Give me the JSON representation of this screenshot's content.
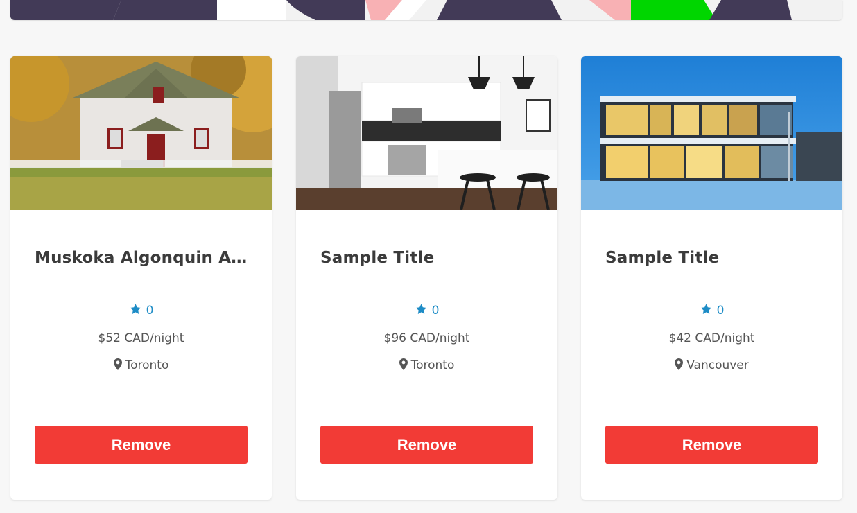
{
  "cards": [
    {
      "title": "Muskoka Algonquin Arr...",
      "rating": "0",
      "price": "$52 CAD/night",
      "location": "Toronto",
      "remove_label": "Remove",
      "image": "house-exterior-autumn"
    },
    {
      "title": "Sample Title",
      "rating": "0",
      "price": "$96 CAD/night",
      "location": "Toronto",
      "remove_label": "Remove",
      "image": "modern-kitchen"
    },
    {
      "title": "Sample Title",
      "rating": "0",
      "price": "$42 CAD/night",
      "location": "Vancouver",
      "remove_label": "Remove",
      "image": "modern-house-winter-night"
    }
  ],
  "icons": {
    "rating": "star-icon",
    "location": "map-pin-icon"
  },
  "colors": {
    "accent": "#1d8cc6",
    "remove_button": "#f23b36",
    "title": "#3b3b3b",
    "text": "#555555"
  }
}
